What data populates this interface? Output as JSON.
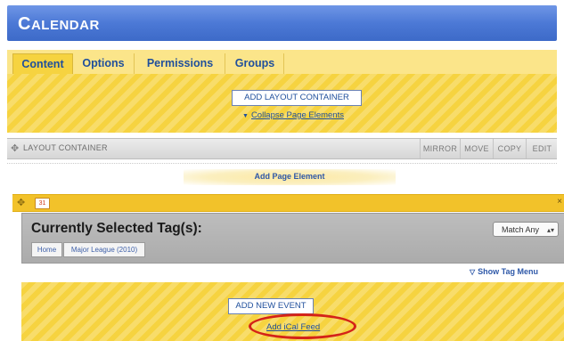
{
  "window": {
    "title": "Calendar"
  },
  "tabs": [
    {
      "label": "Content",
      "active": true
    },
    {
      "label": "Options",
      "active": false
    },
    {
      "label": "Permissions",
      "active": false
    },
    {
      "label": "Groups",
      "active": false
    }
  ],
  "content_area": {
    "add_layout_container_label": "ADD LAYOUT CONTAINER",
    "collapse_label": "Collapse Page Elements"
  },
  "layout_container": {
    "label": "LAYOUT CONTAINER",
    "actions": {
      "mirror": "MIRROR",
      "move": "MOVE",
      "copy": "COPY",
      "edit": "EDIT"
    }
  },
  "add_page_element_label": "Add Page Element",
  "element_bar": {
    "calendar_icon_text": "31",
    "close_symbol": "×"
  },
  "tag_panel": {
    "title": "Currently Selected Tag(s):",
    "breadcrumbs": [
      "Home",
      "Major League (2010)"
    ],
    "match_select_value": "Match Any"
  },
  "show_tag_menu_label": "Show Tag Menu",
  "bottom_area": {
    "add_new_event_label": "ADD NEW EVENT",
    "add_ical_label": "Add iCal Feed"
  },
  "colors": {
    "title_bar_blue": "#4c79d6",
    "accent_yellow": "#f6d340",
    "link_blue": "#1f4f9c",
    "highlight_red": "#d42318"
  }
}
